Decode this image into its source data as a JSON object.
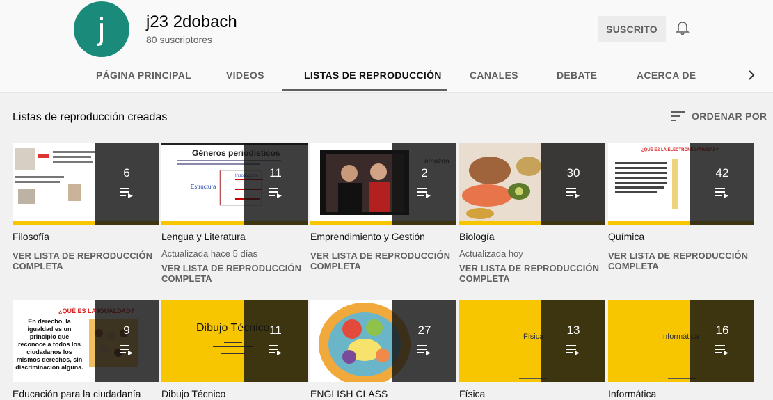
{
  "channel": {
    "avatar_letter": "j",
    "name": "j23 2dobach",
    "subscribers": "80 suscriptores",
    "subscribe_label": "SUSCRITO",
    "accent_color": "#1a8a7a"
  },
  "tabs": [
    {
      "label": "PÁGINA PRINCIPAL"
    },
    {
      "label": "VIDEOS"
    },
    {
      "label": "LISTAS DE REPRODUCCIÓN",
      "active": true
    },
    {
      "label": "CANALES"
    },
    {
      "label": "DEBATE"
    },
    {
      "label": "ACERCA DE"
    }
  ],
  "section": {
    "title": "Listas de reproducción creadas",
    "sort_label": "ORDENAR POR"
  },
  "playlists": [
    {
      "title": "Filosofía",
      "count": "6",
      "updated": "",
      "link": "VER LISTA DE REPRODUCCIÓN COMPLETA"
    },
    {
      "title": "Lengua y Literatura",
      "count": "11",
      "updated": "Actualizada hace 5 días",
      "link": "VER LISTA DE REPRODUCCIÓN COMPLETA",
      "thumb_text": "Géneros periodísticos",
      "thumb_sub": "Estructura",
      "thumb_sub2": "Introducción"
    },
    {
      "title": "Emprendimiento y Gestión",
      "count": "2",
      "updated": "",
      "link": "VER LISTA DE REPRODUCCIÓN COMPLETA",
      "thumb_text": "amazon"
    },
    {
      "title": "Biología",
      "count": "30",
      "updated": "Actualizada hoy",
      "link": "VER LISTA DE REPRODUCCIÓN COMPLETA"
    },
    {
      "title": "Química",
      "count": "42",
      "updated": "",
      "link": "VER LISTA DE REPRODUCCIÓN COMPLETA",
      "thumb_text": "¿QUÉ ES LA ELECTRONEGATIVIDAD?"
    },
    {
      "title": "Educación para la ciudadanía",
      "count": "9",
      "updated": "",
      "link": "",
      "thumb_text": "¿QUÉ ES LA IGUALDAD?",
      "thumb_sub": "En derecho, la igualdad es un principio que reconoce a todos los ciudadanos los mismos derechos, sin discriminación alguna."
    },
    {
      "title": "Dibujo Técnico",
      "count": "11",
      "updated": "",
      "link": "",
      "thumb_text": "Dibujo Técnico"
    },
    {
      "title": "ENGLISH CLASS",
      "count": "27",
      "updated": "",
      "link": ""
    },
    {
      "title": "Física",
      "count": "13",
      "updated": "",
      "link": "",
      "thumb_text": "Física"
    },
    {
      "title": "Informática",
      "count": "16",
      "updated": "",
      "link": "",
      "thumb_text": "Informática"
    }
  ],
  "colors": {
    "thumb_yellow": "#f7c600",
    "overlay_dark": "#141414",
    "muted_text": "#606060"
  }
}
